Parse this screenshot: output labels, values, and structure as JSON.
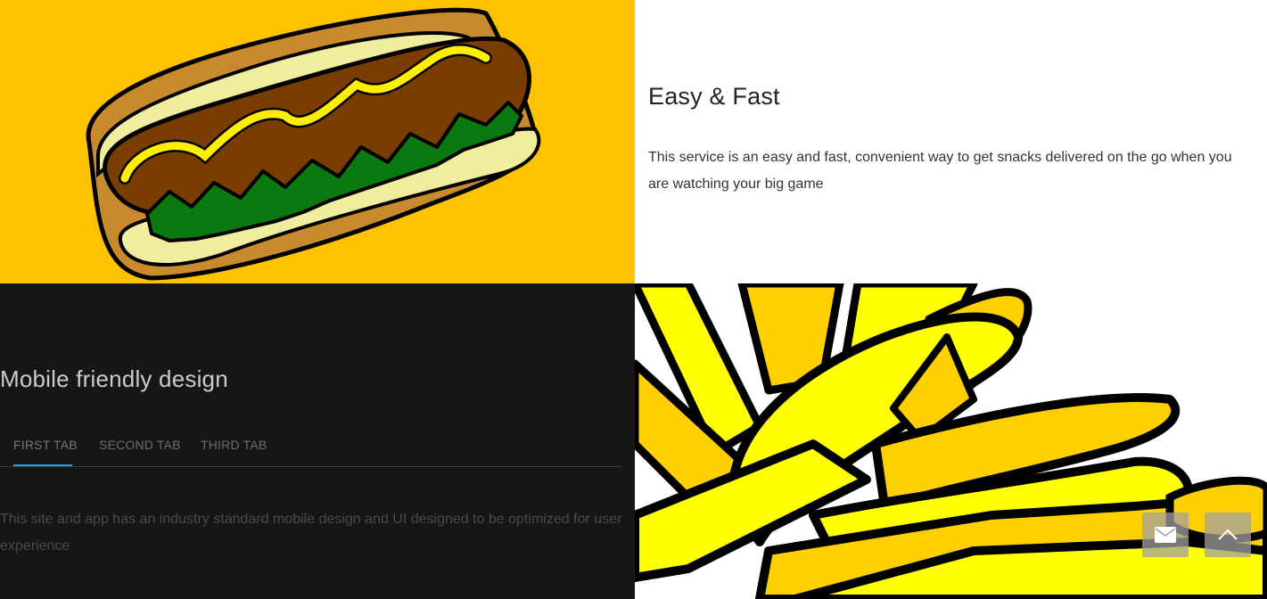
{
  "features": {
    "easy": {
      "title": "Easy & Fast",
      "text": "This service is an easy and fast, convenient way to get snacks delivered on the go when you are watching your big game"
    },
    "mobile": {
      "title": "Mobile friendly design",
      "tabs": [
        {
          "label": "FIRST TAB",
          "active": true
        },
        {
          "label": "SECOND TAB",
          "active": false
        },
        {
          "label": "THIRD TAB",
          "active": false
        }
      ],
      "text": "This site and app has an industry standard mobile design and UI designed to be optimized for user experience"
    }
  },
  "images": {
    "hotdog": "hotdog-illustration",
    "fries": "fries-illustration"
  },
  "floating_buttons": {
    "mail_icon": "envelope-icon",
    "top_icon": "chevron-up-icon"
  },
  "colors": {
    "hotdog_bg": "#fec201",
    "dark_bg": "#161616",
    "tab_accent": "#1ea4d9",
    "fries_yellow": "#ffff00"
  }
}
